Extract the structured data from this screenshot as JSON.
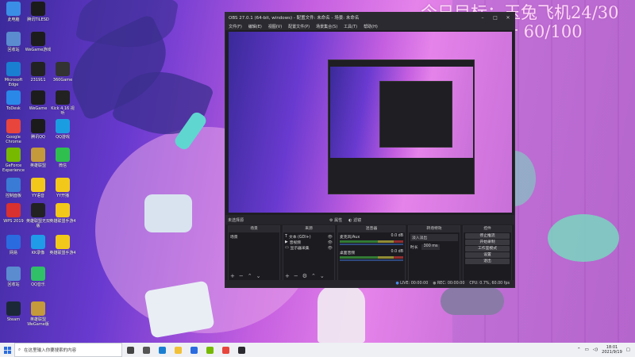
{
  "overlay": {
    "line1": "今日目标：玉兔飞机24/30",
    "line2": "圆月十 60/100"
  },
  "desktop_icons": [
    {
      "label": "此电脑",
      "icon": "computer-icon",
      "color": "#3a8ee6"
    },
    {
      "label": "腾讯TILESD",
      "icon": "tencent-game-icon",
      "color": "#1b1b1b"
    },
    {
      "label": "回收站",
      "icon": "recycle-bin-icon",
      "color": "#5a8ccf"
    },
    {
      "label": "WeGame游戏",
      "icon": "wegame-icon",
      "color": "#1c1c1c"
    },
    {
      "label": "Microsoft Edge",
      "icon": "edge-icon",
      "color": "#1b7fd1"
    },
    {
      "label": "231911",
      "icon": "game-icon",
      "color": "#222"
    },
    {
      "label": "360Game",
      "icon": "game-icon",
      "color": "#333"
    },
    {
      "label": "ToDesk",
      "icon": "todesk-icon",
      "color": "#2a88e8"
    },
    {
      "label": "WeGame",
      "icon": "wegame-icon",
      "color": "#1c1c1c"
    },
    {
      "label": "Kick 4.16 视听",
      "icon": "app-icon",
      "color": "#222"
    },
    {
      "label": "Google Chrome",
      "icon": "chrome-icon",
      "color": "#e8453c"
    },
    {
      "label": "腾讯QQ",
      "icon": "qq-icon",
      "color": "#1b1b1b"
    },
    {
      "label": "QQ游戏",
      "icon": "qq-game-icon",
      "color": "#1b9de2"
    },
    {
      "label": "GeForce Experience",
      "icon": "geforce-icon",
      "color": "#76b900"
    },
    {
      "label": "英雄联盟",
      "icon": "lol-icon",
      "color": "#c49a3a"
    },
    {
      "label": "微信",
      "icon": "wechat-icon",
      "color": "#2fbf4f"
    },
    {
      "label": "控制面板",
      "icon": "control-panel-icon",
      "color": "#3a7bd5"
    },
    {
      "label": "YY语音",
      "icon": "yy-icon",
      "color": "#f2c81a"
    },
    {
      "label": "YY开播",
      "icon": "yy-icon",
      "color": "#f2c81a"
    },
    {
      "label": "WPS 2019",
      "icon": "wps-icon",
      "color": "#d8312f"
    },
    {
      "label": "英雄联盟无双版",
      "icon": "lol-icon",
      "color": "#222"
    },
    {
      "label": "英雄联盟手游4",
      "icon": "game-icon",
      "color": "#f2c81a"
    },
    {
      "label": "网易",
      "icon": "netease-icon",
      "color": "#2a6be0"
    },
    {
      "label": "KK录像",
      "icon": "kk-icon",
      "color": "#1f9be8"
    },
    {
      "label": "英雄联盟手游4",
      "icon": "game-icon",
      "color": "#f2c81a"
    },
    {
      "label": "回收站",
      "icon": "recycle-bin-icon",
      "color": "#5a8ccf"
    },
    {
      "label": "QQ音乐",
      "icon": "qq-music-icon",
      "color": "#30c067"
    },
    {
      "label": "Steam",
      "icon": "steam-icon",
      "color": "#1b2838"
    },
    {
      "label": "英雄联盟 WeGame版",
      "icon": "lol-icon",
      "color": "#c49a3a"
    }
  ],
  "obs": {
    "title": "OBS 27.0.1 (64-bit, windows) - 配置文件: 未命名 - 场景: 未命名",
    "menu": [
      "文件(F)",
      "编辑(E)",
      "视图(V)",
      "配置文件(P)",
      "场景集合(S)",
      "工具(T)",
      "帮助(H)"
    ],
    "scene_bar": [
      "未选择源",
      "属性",
      "滤镜"
    ],
    "docks": {
      "scenes": {
        "title": "场景",
        "items": [
          "场景"
        ]
      },
      "sources": {
        "title": "来源",
        "items": [
          "文本 (GDI+)",
          "音视频",
          "显示器采集"
        ]
      },
      "mixer": {
        "title": "混音器",
        "channels": [
          {
            "name": "麦克风/Aux",
            "level": "0.0 dB"
          },
          {
            "name": "桌面音频",
            "level": "0.0 dB"
          }
        ]
      },
      "transitions": {
        "title": "转场特效",
        "mode": "淡入淡出",
        "duration_label": "时长",
        "duration": "300 ms"
      },
      "controls": {
        "title": "控件",
        "buttons": [
          "停止推流",
          "开始录制",
          "工作室模式",
          "设置",
          "退出"
        ]
      }
    },
    "status": {
      "live": "LIVE: 00:00:00",
      "rec": "REC: 00:00:00",
      "cpu": "CPU: 0.7%, 60.00 fps"
    }
  },
  "taskbar": {
    "search_placeholder": "在这里输入你要搜索的内容",
    "apps": [
      {
        "icon": "cortana-icon",
        "color": "#444"
      },
      {
        "icon": "task-view-icon",
        "color": "#555"
      },
      {
        "icon": "edge-icon",
        "color": "#1b7fd1"
      },
      {
        "icon": "file-explorer-icon",
        "color": "#f2c036"
      },
      {
        "icon": "mail-icon",
        "color": "#2a6be0"
      },
      {
        "icon": "geforce-icon",
        "color": "#76b900"
      },
      {
        "icon": "chrome-icon",
        "color": "#e8453c"
      },
      {
        "icon": "obs-icon",
        "color": "#2b2a30"
      }
    ],
    "time": "18:01",
    "date": "2021/9/19"
  }
}
